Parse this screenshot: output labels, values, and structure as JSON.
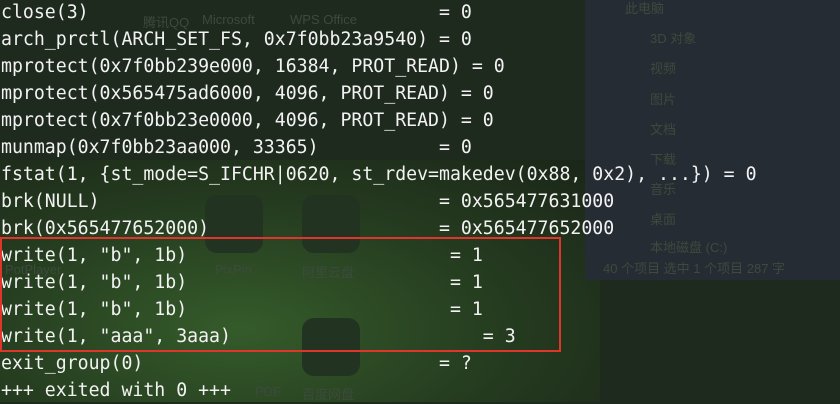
{
  "background": {
    "explorer_items": [
      "此电脑",
      "3D 对象",
      "视频",
      "图片",
      "文档",
      "下载",
      "音乐",
      "桌面",
      "本地磁盘 (C:)"
    ],
    "explorer_status": "40 个项目    选中 1 个项目  287 字",
    "desktop_labels": [
      "腾讯QQ",
      "Microsoft",
      "WPS Office",
      "PotPlayer",
      "PixPin",
      "阿里云盘",
      "PDF",
      "百度网盘"
    ]
  },
  "terminal": {
    "lines": [
      "close(3)                                = 0",
      "arch_prctl(ARCH_SET_FS, 0x7f0bb23a9540) = 0",
      "mprotect(0x7f0bb239e000, 16384, PROT_READ) = 0",
      "mprotect(0x565475ad6000, 4096, PROT_READ) = 0",
      "mprotect(0x7f0bb23e0000, 4096, PROT_READ) = 0",
      "munmap(0x7f0bb23aa000, 33365)           = 0",
      "fstat(1, {st_mode=S_IFCHR|0620, st_rdev=makedev(0x88, 0x2), ...}) = 0",
      "brk(NULL)                               = 0x565477631000",
      "brk(0x565477652000)                     = 0x565477652000",
      "write(1, \"b\", 1b)                        = 1",
      "write(1, \"b\", 1b)                        = 1",
      "write(1, \"b\", 1b)                        = 1",
      "write(1, \"aaa\", 3aaa)                       = 3",
      "exit_group(0)                           = ?",
      "+++ exited with 0 +++"
    ]
  },
  "highlight_color": "#e0352b"
}
